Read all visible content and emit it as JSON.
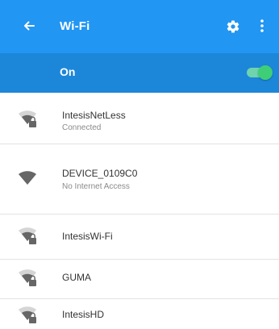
{
  "app_bar": {
    "title": "Wi-Fi",
    "back_icon": "arrow-left-icon",
    "settings_icon": "gear-icon",
    "more_icon": "more-vert-icon",
    "color": "#2196f3"
  },
  "wifi_toggle": {
    "label": "On",
    "state": "on",
    "bar_color": "#1c87d9",
    "toggle_color": "#3fce78"
  },
  "networks": [
    {
      "name": "IntesisNetLess",
      "status": "Connected",
      "icon": "wifi-locked-icon"
    },
    {
      "name": "DEVICE_0109C0",
      "status": "No Internet Access",
      "icon": "wifi-full-icon"
    },
    {
      "name": "IntesisWi-Fi",
      "status": "",
      "icon": "wifi-locked-icon"
    },
    {
      "name": "GUMA",
      "status": "",
      "icon": "wifi-locked-icon"
    },
    {
      "name": "IntesisHD",
      "status": "",
      "icon": "wifi-locked-icon"
    }
  ]
}
